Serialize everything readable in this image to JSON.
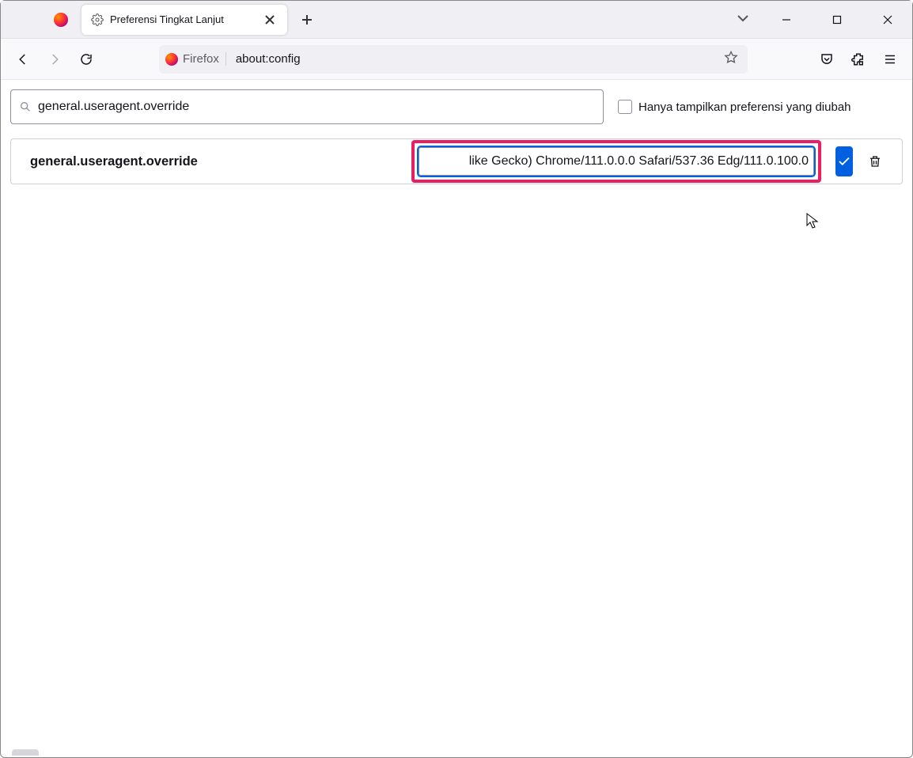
{
  "tab": {
    "title": "Preferensi Tingkat Lanjut"
  },
  "urlbar": {
    "identity": "Firefox",
    "address": "about:config"
  },
  "search": {
    "value": "general.useragent.override"
  },
  "filter": {
    "label": "Hanya tampilkan preferensi yang diubah"
  },
  "pref": {
    "name": "general.useragent.override",
    "value": "like Gecko) Chrome/111.0.0.0 Safari/537.36 Edg/111.0.100.0"
  }
}
